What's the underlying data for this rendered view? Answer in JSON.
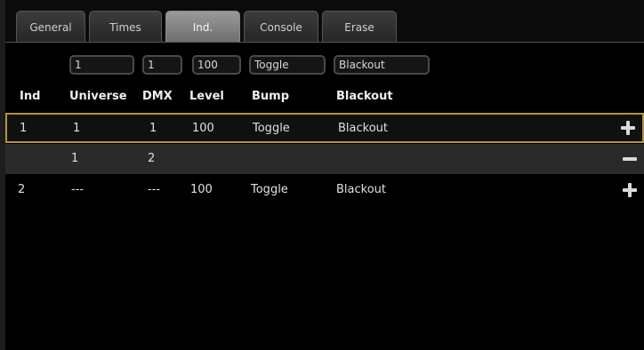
{
  "tabs": [
    {
      "label": "General"
    },
    {
      "label": "Times"
    },
    {
      "label": "Ind."
    },
    {
      "label": "Console"
    },
    {
      "label": "Erase"
    }
  ],
  "filters": {
    "universe": "1",
    "dmx": "1",
    "level": "100",
    "bump": "Toggle",
    "blackout": "Blackout"
  },
  "headers": {
    "ind": "Ind",
    "universe": "Universe",
    "dmx": "DMX",
    "level": "Level",
    "bump": "Bump",
    "blackout": "Blackout"
  },
  "rows": [
    {
      "ind": "1",
      "universe": "1",
      "dmx": "1",
      "level": "100",
      "bump": "Toggle",
      "blackout": "Blackout",
      "action": "plus-icon"
    },
    {
      "ind": "",
      "universe": "1",
      "dmx": "2",
      "level": "",
      "bump": "",
      "blackout": "",
      "action": "minus-icon"
    },
    {
      "ind": "2",
      "universe": "---",
      "dmx": "---",
      "level": "100",
      "bump": "Toggle",
      "blackout": "Blackout",
      "action": "plus-icon"
    }
  ],
  "colors": {
    "selected_row_border": "#b8923a",
    "active_tab": "#8a8a8a"
  }
}
